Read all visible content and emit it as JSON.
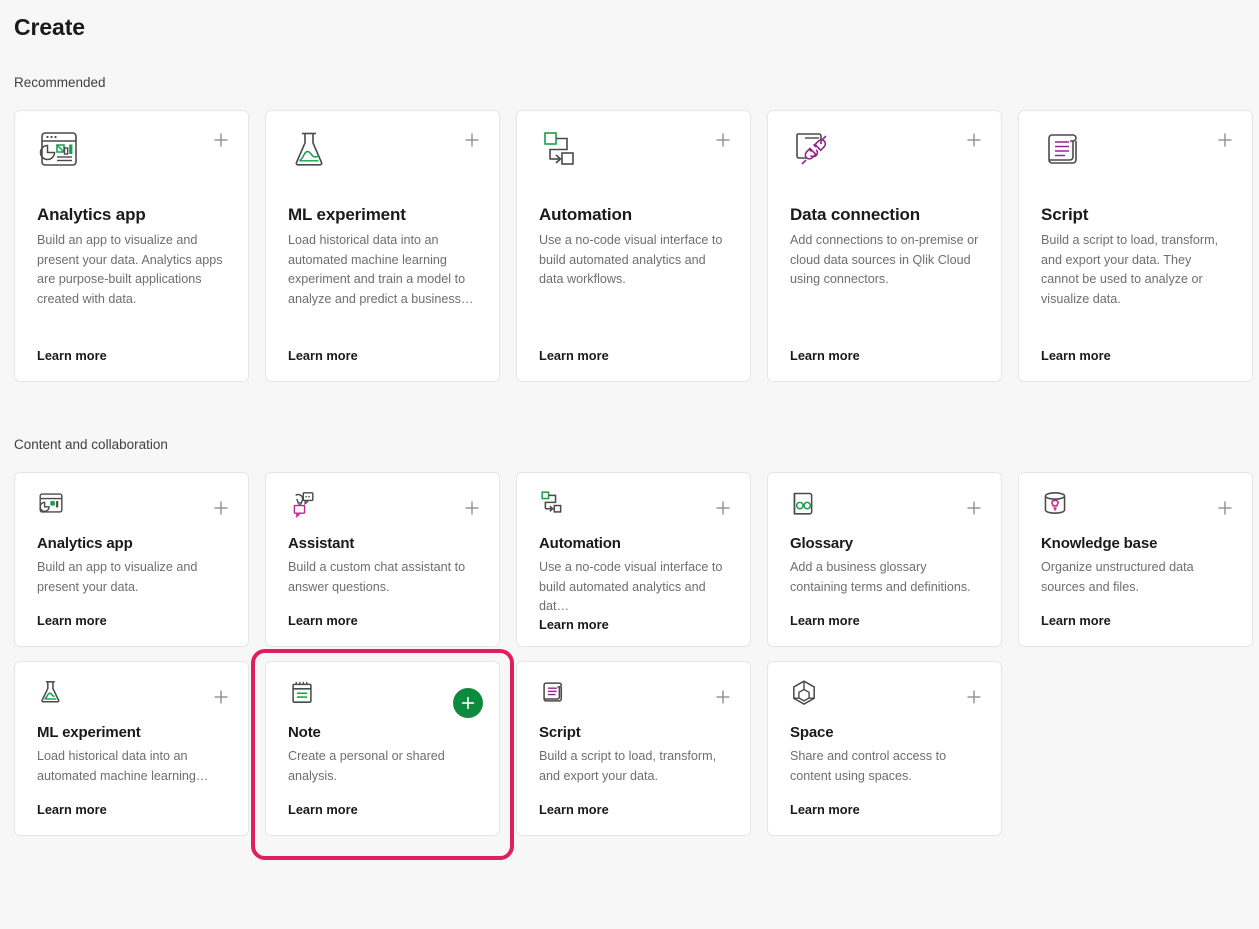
{
  "page": {
    "title": "Create"
  },
  "sections": [
    {
      "label": "Recommended",
      "cards": [
        {
          "icon": "analytics-app-icon",
          "title": "Analytics app",
          "description": "Build an app to visualize and present your data. Analytics apps are purpose-built applications created with data.",
          "link": "Learn more",
          "plus": "+"
        },
        {
          "icon": "ml-experiment-flask-icon",
          "title": "ML experiment",
          "description": "Load historical data into an automated machine learning experiment and train a model to analyze and predict a business…",
          "link": "Learn more",
          "plus": "+"
        },
        {
          "icon": "automation-flow-icon",
          "title": "Automation",
          "description": "Use a no-code visual interface to build automated analytics and data workflows.",
          "link": "Learn more",
          "plus": "+"
        },
        {
          "icon": "data-connection-plug-icon",
          "title": "Data connection",
          "description": "Add connections to on-premise or cloud data sources in Qlik Cloud using connectors.",
          "link": "Learn more",
          "plus": "+"
        },
        {
          "icon": "script-scroll-icon",
          "title": "Script",
          "description": "Build a script to load, transform, and export your data. They cannot be used to analyze or visualize data.",
          "link": "Learn more",
          "plus": "+"
        }
      ]
    },
    {
      "label": "Content and collaboration",
      "cards": [
        {
          "icon": "analytics-app-icon",
          "title": "Analytics app",
          "description": "Build an app to visualize and present your data.",
          "link": "Learn more",
          "plus": "+"
        },
        {
          "icon": "assistant-chat-bulb-icon",
          "title": "Assistant",
          "description": "Build a custom chat assistant to answer questions.",
          "link": "Learn more",
          "plus": "+"
        },
        {
          "icon": "automation-flow-icon",
          "title": "Automation",
          "description": "Use a no-code visual interface to build automated analytics and dat…",
          "link": "Learn more",
          "plus": "+"
        },
        {
          "icon": "glossary-book-icon",
          "title": "Glossary",
          "description": "Add a business glossary containing terms and definitions.",
          "link": "Learn more",
          "plus": "+"
        },
        {
          "icon": "knowledge-base-cylinder-icon",
          "title": "Knowledge base",
          "description": "Organize unstructured data sources and files.",
          "link": "Learn more",
          "plus": "+"
        },
        {
          "icon": "ml-experiment-flask-icon",
          "title": "ML experiment",
          "description": "Load historical data into an automated machine learning…",
          "link": "Learn more",
          "plus": "+"
        },
        {
          "icon": "note-icon",
          "title": "Note",
          "description": "Create a personal or shared analysis.",
          "link": "Learn more",
          "plus": "+",
          "highlighted": true,
          "plus_active": true
        },
        {
          "icon": "script-scroll-icon",
          "title": "Script",
          "description": "Build a script to load, transform, and export your data.",
          "link": "Learn more",
          "plus": "+"
        },
        {
          "icon": "space-cube-icon",
          "title": "Space",
          "description": "Share and control access to content using spaces.",
          "link": "Learn more",
          "plus": "+"
        }
      ]
    }
  ],
  "colors": {
    "background": "#f7f7f7",
    "card_background": "#ffffff",
    "card_border": "#e6e6e6",
    "title_text": "#1a1a1a",
    "body_text": "#6e6e6e",
    "accent_green": "#0e8a3e",
    "accent_purple": "#96258c",
    "highlight_ring": "#e0205e",
    "plus_grey": "#8f8f8f"
  }
}
